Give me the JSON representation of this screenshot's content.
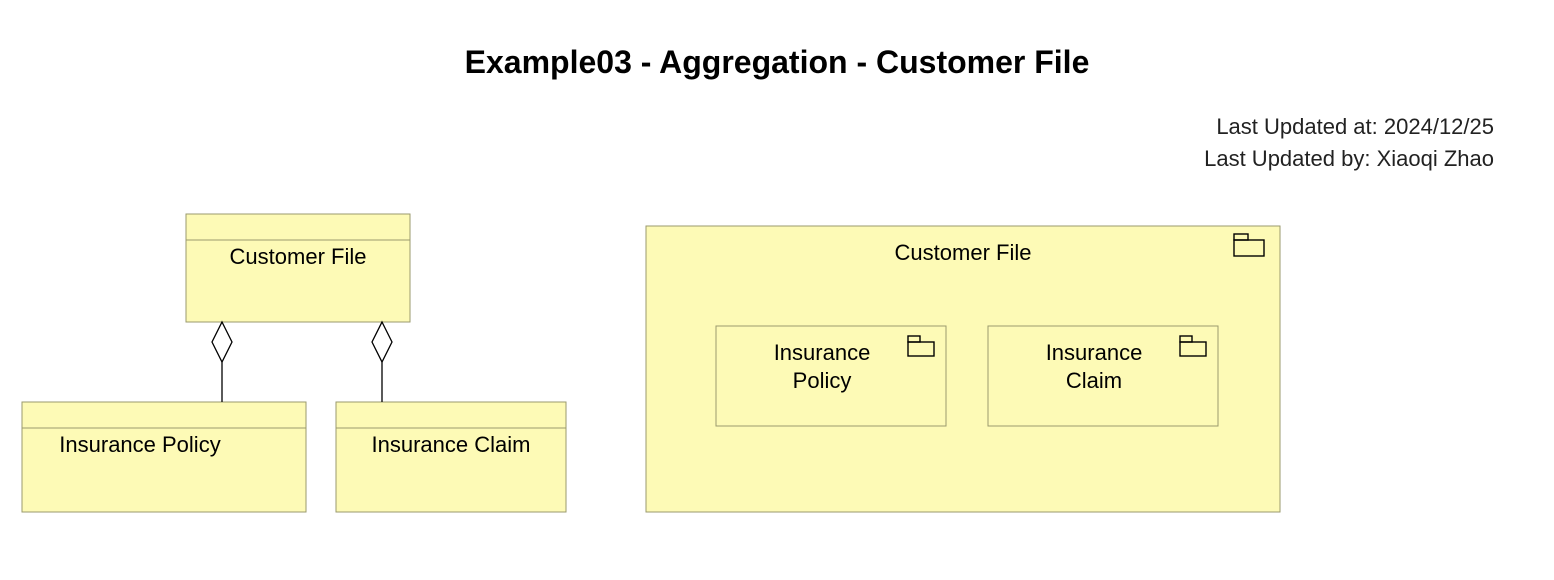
{
  "title": "Example03 - Aggregation - Customer File",
  "meta": {
    "updated_at_label": "Last Updated at:",
    "updated_at_value": "2024/12/25",
    "updated_by_label": "Last Updated by:",
    "updated_by_value": "Xiaoqi Zhao"
  },
  "left": {
    "parent": "Customer File",
    "child1": "Insurance Policy",
    "child2": "Insurance Claim"
  },
  "right": {
    "container": "Customer File",
    "inner1_line1": "Insurance",
    "inner1_line2": "Policy",
    "inner2_line1": "Insurance",
    "inner2_line2": "Claim"
  },
  "colors": {
    "box_fill": "#fdfab6",
    "box_stroke": "#9a9a6d"
  },
  "chart_data": {
    "type": "uml-diagram",
    "notation": "UML Class / Aggregation and Package-style containment",
    "left_view": {
      "kind": "aggregation-tree",
      "whole": "Customer File",
      "parts": [
        "Insurance Policy",
        "Insurance Claim"
      ],
      "relationship": "aggregation (hollow diamond at whole end)"
    },
    "right_view": {
      "kind": "containment",
      "container": "Customer File",
      "contained": [
        "Insurance Policy",
        "Insurance Claim"
      ]
    }
  }
}
